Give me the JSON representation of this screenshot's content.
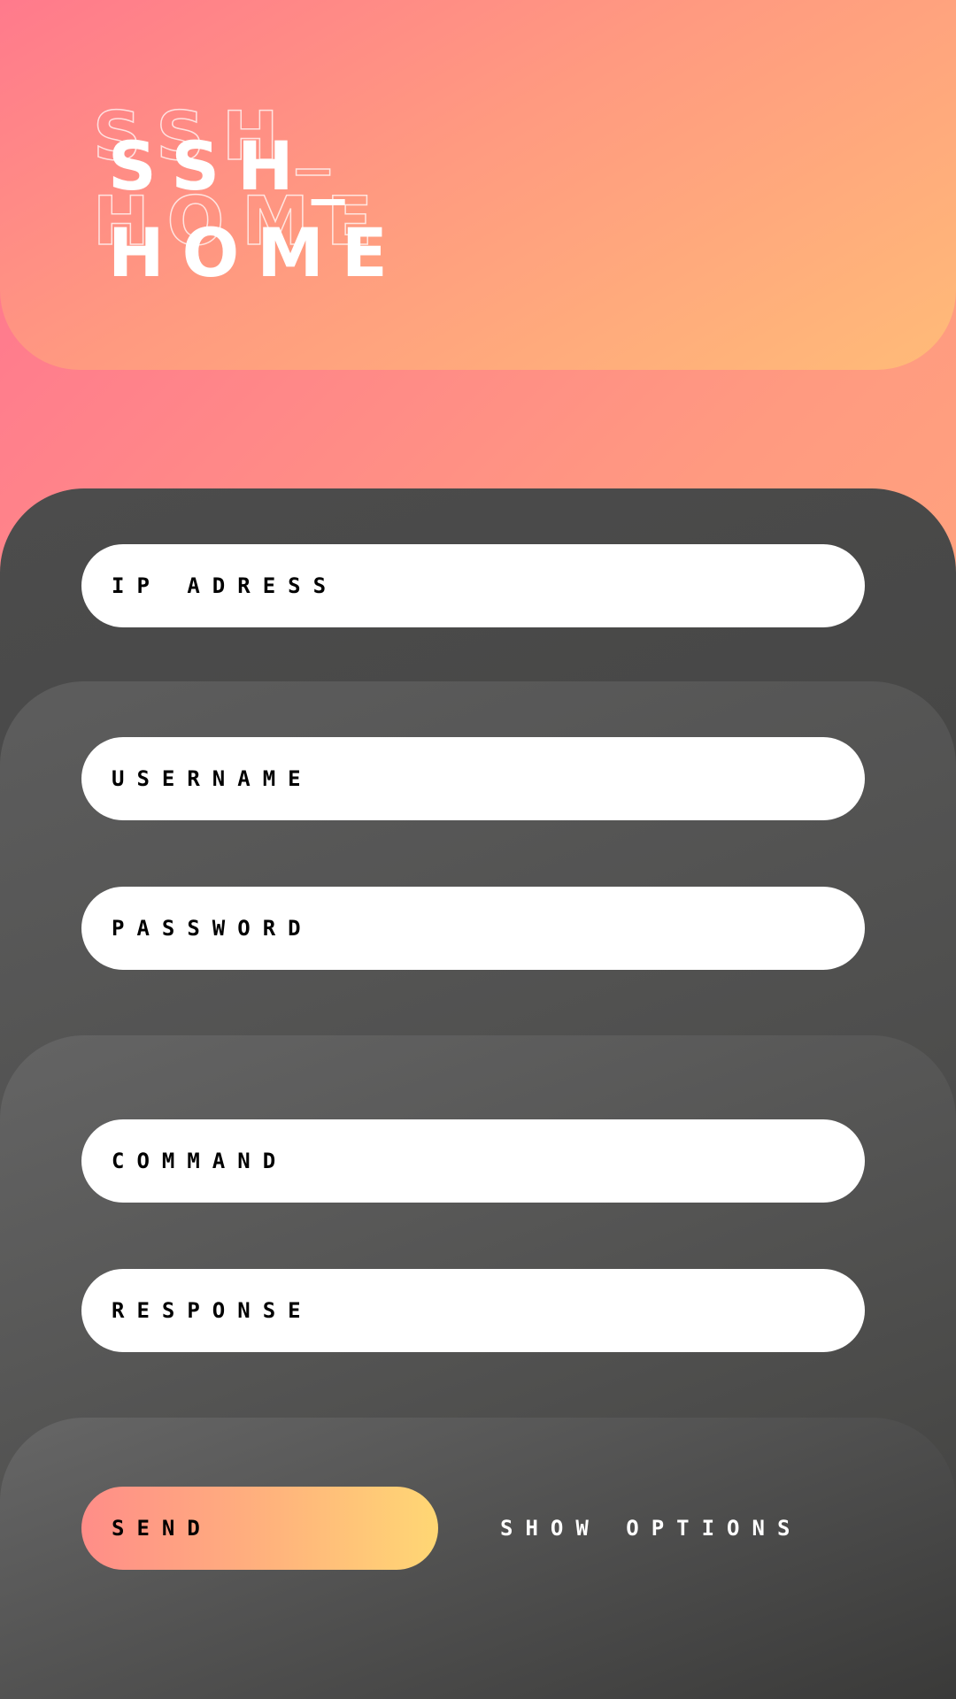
{
  "app": {
    "title_line_1": "SSH_",
    "title_line_2": "HOME"
  },
  "connection": {
    "ip_placeholder": "IP ADRESS"
  },
  "credentials": {
    "username_placeholder": "USERNAME",
    "password_placeholder": "PASSWORD"
  },
  "terminal": {
    "command_placeholder": "COMMAND",
    "response_placeholder": "RESPONSE"
  },
  "actions": {
    "send_label": "SEND",
    "options_label": "SHOW OPTIONS"
  },
  "colors": {
    "background_start": "#ff7092",
    "background_end": "#ffba78",
    "panel_dark": "#3f3f3d",
    "send_start": "#ff8d88",
    "send_end": "#ffd774"
  }
}
